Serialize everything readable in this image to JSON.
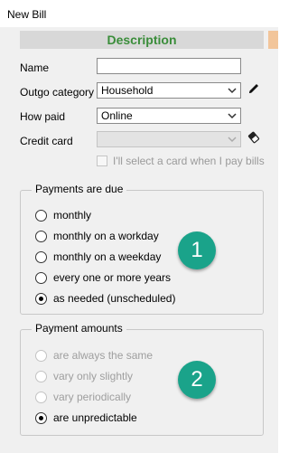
{
  "window": {
    "title": "New Bill"
  },
  "description": {
    "header": "Description"
  },
  "form": {
    "name": {
      "label": "Name",
      "value": ""
    },
    "outgo_category": {
      "label": "Outgo category",
      "value": "Household"
    },
    "how_paid": {
      "label": "How paid",
      "value": "Online"
    },
    "credit_card": {
      "label": "Credit card",
      "value": ""
    },
    "select_card_checkbox": {
      "label": "I'll select a card when I pay bills",
      "checked": false
    }
  },
  "payments_due": {
    "title": "Payments are due",
    "options": [
      {
        "label": "monthly",
        "selected": false
      },
      {
        "label": "monthly on a workday",
        "selected": false
      },
      {
        "label": "monthly on a weekday",
        "selected": false
      },
      {
        "label": "every one or more years",
        "selected": false
      },
      {
        "label": "as needed (unscheduled)",
        "selected": true
      }
    ],
    "badge": "1"
  },
  "payment_amounts": {
    "title": "Payment amounts",
    "options": [
      {
        "label": "are always the same",
        "selected": false,
        "disabled": true
      },
      {
        "label": "vary only slightly",
        "selected": false,
        "disabled": true
      },
      {
        "label": "vary periodically",
        "selected": false,
        "disabled": true
      },
      {
        "label": "are unpredictable",
        "selected": true,
        "disabled": false
      }
    ],
    "badge": "2"
  },
  "colors": {
    "header_text": "#3a8d3a",
    "header_bg": "#d8d8d8",
    "badge": "#1aa38a",
    "tab_accent": "#f2c59a"
  },
  "icons": {
    "edit": "pencil-icon",
    "clear": "eraser-icon",
    "dropdown": "chevron-down-icon"
  }
}
